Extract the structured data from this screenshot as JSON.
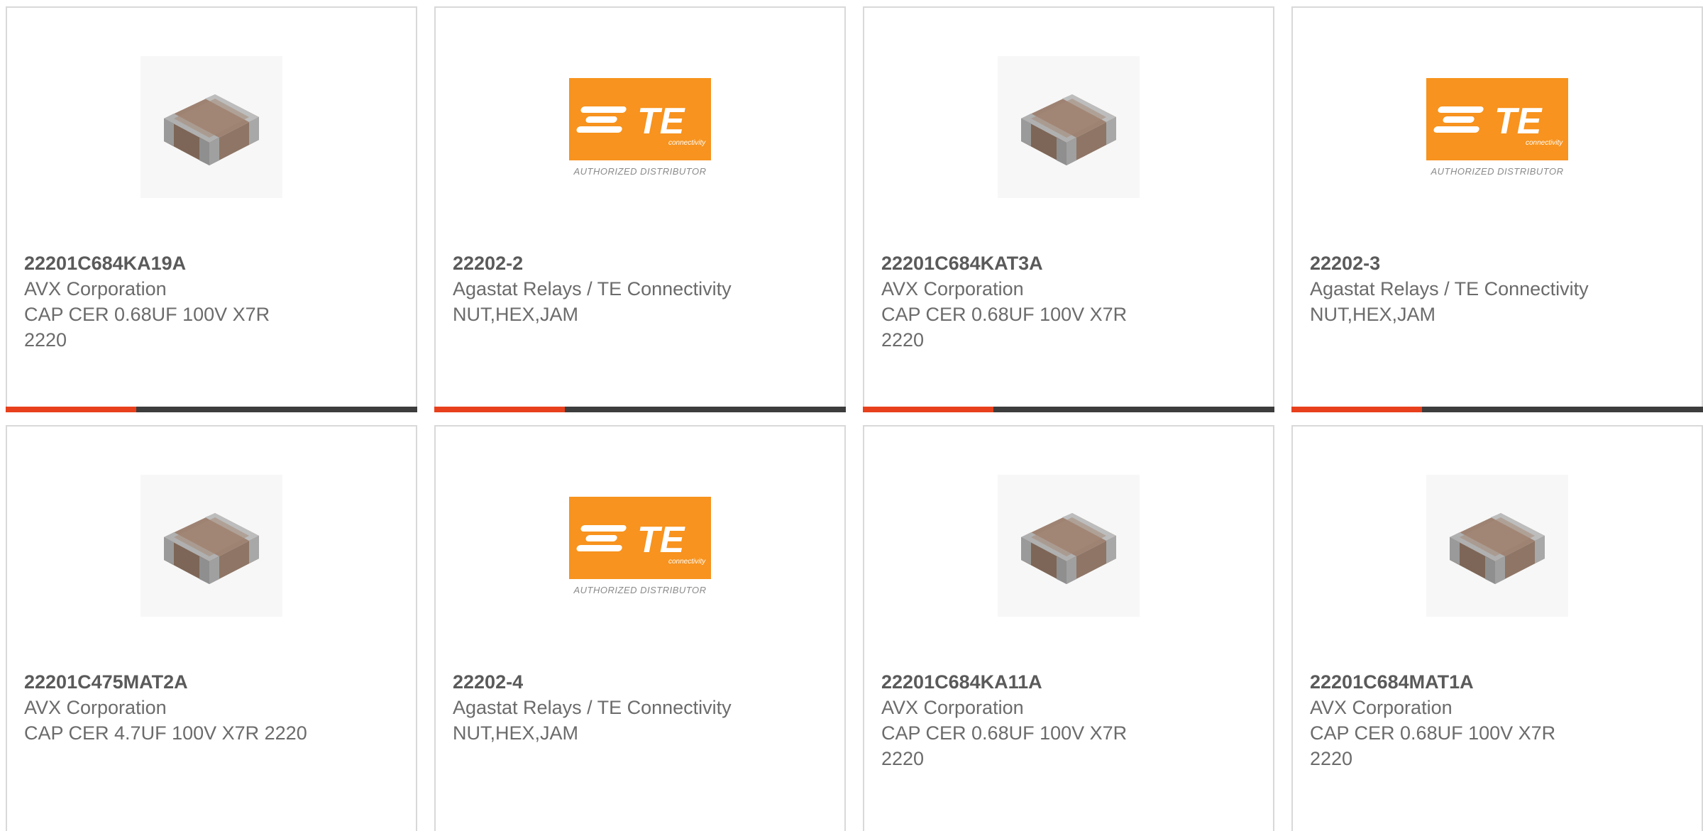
{
  "colors": {
    "accent": "#e8401c",
    "bar": "#3d3d3d",
    "te_orange": "#f7931e"
  },
  "cards": [
    {
      "part_number": "22201C684KA19A",
      "manufacturer": "AVX Corporation",
      "description_line1": "CAP CER 0.68UF 100V X7R",
      "description_line2": "2220",
      "image": "capacitor-chip-icon",
      "show_bar": true
    },
    {
      "part_number": "22202-2",
      "manufacturer": "Agastat Relays / TE Connectivity",
      "description_line1": "NUT,HEX,JAM",
      "description_line2": "",
      "image": "te-connectivity-logo",
      "logo_text": "TE",
      "logo_sub": "connectivity",
      "logo_caption": "AUTHORIZED DISTRIBUTOR",
      "show_bar": true
    },
    {
      "part_number": "22201C684KAT3A",
      "manufacturer": "AVX Corporation",
      "description_line1": "CAP CER 0.68UF 100V X7R",
      "description_line2": "2220",
      "image": "capacitor-chip-icon",
      "show_bar": true
    },
    {
      "part_number": "22202-3",
      "manufacturer": "Agastat Relays / TE Connectivity",
      "description_line1": "NUT,HEX,JAM",
      "description_line2": "",
      "image": "te-connectivity-logo",
      "logo_text": "TE",
      "logo_sub": "connectivity",
      "logo_caption": "AUTHORIZED DISTRIBUTOR",
      "show_bar": true
    },
    {
      "part_number": "22201C475MAT2A",
      "manufacturer": "AVX Corporation",
      "description_line1": "CAP CER 4.7UF 100V X7R 2220",
      "description_line2": "",
      "image": "capacitor-chip-icon",
      "show_bar": false
    },
    {
      "part_number": "22202-4",
      "manufacturer": "Agastat Relays / TE Connectivity",
      "description_line1": "NUT,HEX,JAM",
      "description_line2": "",
      "image": "te-connectivity-logo",
      "logo_text": "TE",
      "logo_sub": "connectivity",
      "logo_caption": "AUTHORIZED DISTRIBUTOR",
      "show_bar": false
    },
    {
      "part_number": "22201C684KA11A",
      "manufacturer": "AVX Corporation",
      "description_line1": "CAP CER 0.68UF 100V X7R",
      "description_line2": "2220",
      "image": "capacitor-chip-icon",
      "show_bar": false
    },
    {
      "part_number": "22201C684MAT1A",
      "manufacturer": "AVX Corporation",
      "description_line1": "CAP CER 0.68UF 100V X7R",
      "description_line2": "2220",
      "image": "capacitor-chip-icon",
      "show_bar": false
    }
  ]
}
